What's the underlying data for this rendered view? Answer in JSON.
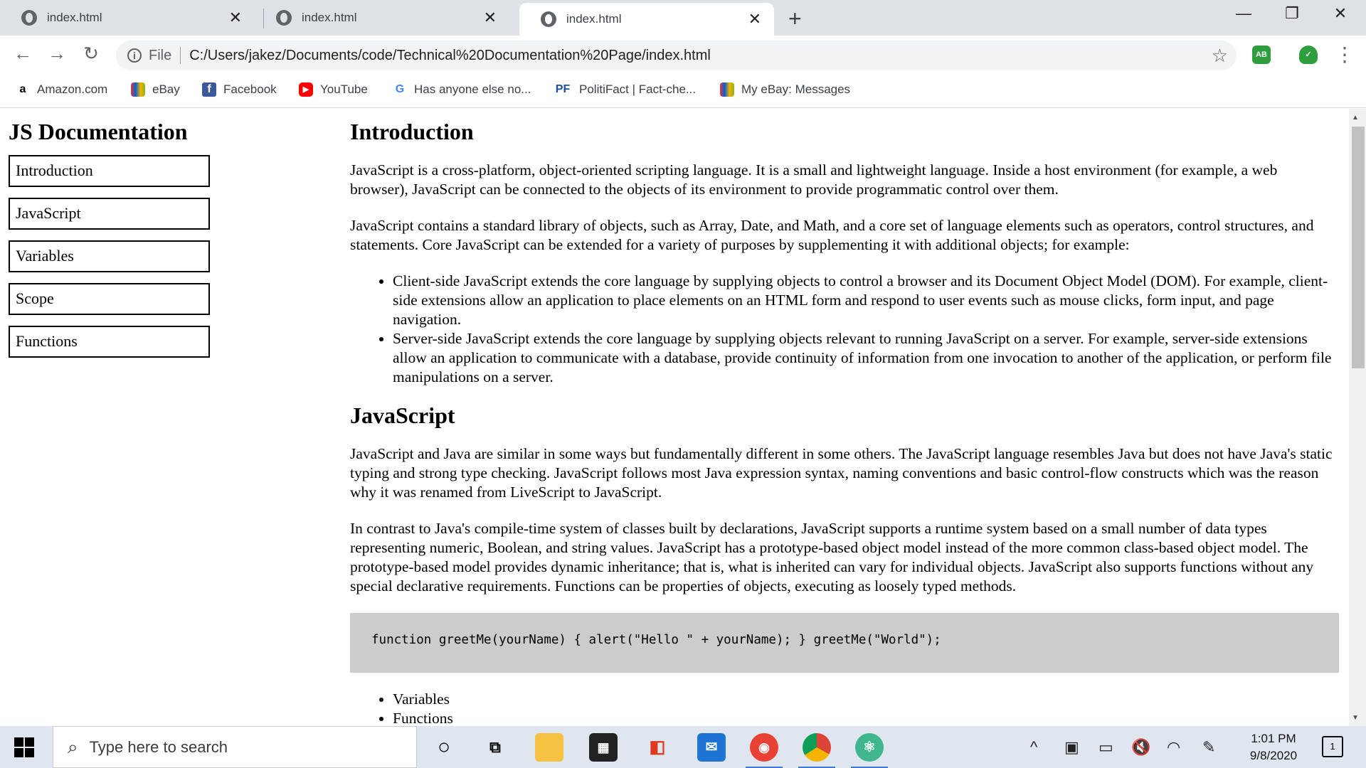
{
  "tabs": [
    {
      "title": "index.html"
    },
    {
      "title": "index.html"
    },
    {
      "title": "index.html"
    }
  ],
  "address": {
    "scheme_label": "File",
    "url": "C:/Users/jakez/Documents/code/Technical%20Documentation%20Page/index.html"
  },
  "extensions": [
    {
      "label": "AB",
      "color": "#2e9e3f"
    },
    {
      "label": "✓",
      "color": "#2e9e3f"
    }
  ],
  "bookmarks": [
    {
      "icon": "a",
      "label": "Amazon.com"
    },
    {
      "icon": "bag",
      "label": "eBay"
    },
    {
      "icon": "f",
      "label": "Facebook"
    },
    {
      "icon": "▶",
      "label": "YouTube"
    },
    {
      "icon": "G",
      "label": "Has anyone else no..."
    },
    {
      "icon": "PF",
      "label": "PolitiFact | Fact-che..."
    },
    {
      "icon": "bag",
      "label": "My eBay: Messages"
    }
  ],
  "page": {
    "sidebar_title": "JS Documentation",
    "nav": [
      "Introduction",
      "JavaScript",
      "Variables",
      "Scope",
      "Functions"
    ],
    "intro": {
      "heading": "Introduction",
      "p1": "JavaScript is a cross-platform, object-oriented scripting language. It is a small and lightweight language. Inside a host environment (for example, a web browser), JavaScript can be connected to the objects of its environment to provide programmatic control over them.",
      "p2": "JavaScript contains a standard library of objects, such as Array, Date, and Math, and a core set of language elements such as operators, control structures, and statements. Core JavaScript can be extended for a variety of purposes by supplementing it with additional objects; for example:",
      "bullets": [
        "Client-side JavaScript extends the core language by supplying objects to control a browser and its Document Object Model (DOM). For example, client-side extensions allow an application to place elements on an HTML form and respond to user events such as mouse clicks, form input, and page navigation.",
        "Server-side JavaScript extends the core language by supplying objects relevant to running JavaScript on a server. For example, server-side extensions allow an application to communicate with a database, provide continuity of information from one invocation to another of the application, or perform file manipulations on a server."
      ]
    },
    "javascript": {
      "heading": "JavaScript",
      "p1": "JavaScript and Java are similar in some ways but fundamentally different in some others. The JavaScript language resembles Java but does not have Java's static typing and strong type checking. JavaScript follows most Java expression syntax, naming conventions and basic control-flow constructs which was the reason why it was renamed from LiveScript to JavaScript.",
      "p2": "In contrast to Java's compile-time system of classes built by declarations, JavaScript supports a runtime system based on a small number of data types representing numeric, Boolean, and string values. JavaScript has a prototype-based object model instead of the more common class-based object model. The prototype-based model provides dynamic inheritance; that is, what is inherited can vary for individual objects. JavaScript also supports functions without any special declarative requirements. Functions can be properties of objects, executing as loosely typed methods.",
      "code": "function greetMe(yourName) { alert(\"Hello \" + yourName); } greetMe(\"World\");",
      "bullets": [
        "Variables",
        "Functions"
      ]
    }
  },
  "taskbar": {
    "search_placeholder": "Type here to search",
    "time": "1:01 PM",
    "date": "9/8/2020",
    "notification_count": "1"
  }
}
